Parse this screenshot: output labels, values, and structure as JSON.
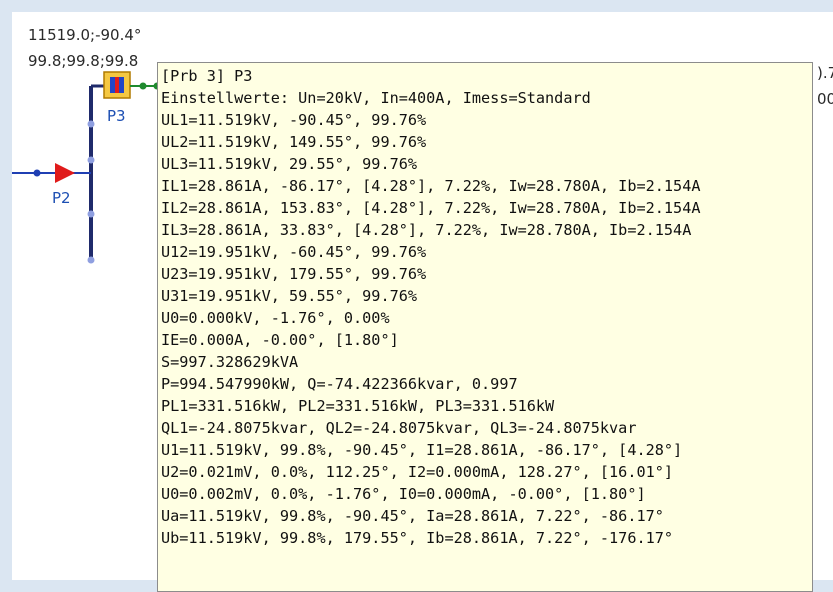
{
  "diagram": {
    "top_label_1": "11519.0;-90.4°",
    "top_label_2": "99.8;99.8;99.8",
    "right_label_1": ").7",
    "right_label_2": "00",
    "device_p3_label": "P3",
    "device_p2_label": "P2",
    "colors": {
      "bus": "#1f2a6b",
      "node": "#8f9fe0",
      "link": "#1f8a2e",
      "arrow": "#e01b1b",
      "box_fill": "#f5c842",
      "box_border": "#b07a00",
      "label_blue": "#1d4fb3"
    }
  },
  "tooltip": {
    "lines": [
      "[Prb 3] P3",
      "Einstellwerte: Un=20kV, In=400A, Imess=Standard",
      "UL1=11.519kV, -90.45°, 99.76%",
      "UL2=11.519kV, 149.55°, 99.76%",
      "UL3=11.519kV, 29.55°, 99.76%",
      "IL1=28.861A, -86.17°, [4.28°], 7.22%, Iw=28.780A, Ib=2.154A",
      "IL2=28.861A, 153.83°, [4.28°], 7.22%, Iw=28.780A, Ib=2.154A",
      "IL3=28.861A, 33.83°, [4.28°], 7.22%, Iw=28.780A, Ib=2.154A",
      "U12=19.951kV, -60.45°, 99.76%",
      "U23=19.951kV, 179.55°, 99.76%",
      "U31=19.951kV, 59.55°, 99.76%",
      "U0=0.000kV, -1.76°, 0.00%",
      "IE=0.000A, -0.00°, [1.80°]",
      "S=997.328629kVA",
      "P=994.547990kW, Q=-74.422366kvar, 0.997",
      "PL1=331.516kW, PL2=331.516kW, PL3=331.516kW",
      "QL1=-24.8075kvar, QL2=-24.8075kvar, QL3=-24.8075kvar",
      "U1=11.519kV, 99.8%, -90.45°, I1=28.861A, -86.17°, [4.28°]",
      "U2=0.021mV, 0.0%, 112.25°, I2=0.000mA, 128.27°, [16.01°]",
      "U0=0.002mV, 0.0%, -1.76°, I0=0.000mA, -0.00°, [1.80°]",
      "Ua=11.519kV, 99.8%, -90.45°, Ia=28.861A, 7.22°, -86.17°",
      "Ub=11.519kV, 99.8%, 179.55°, Ib=28.861A, 7.22°, -176.17°"
    ]
  }
}
